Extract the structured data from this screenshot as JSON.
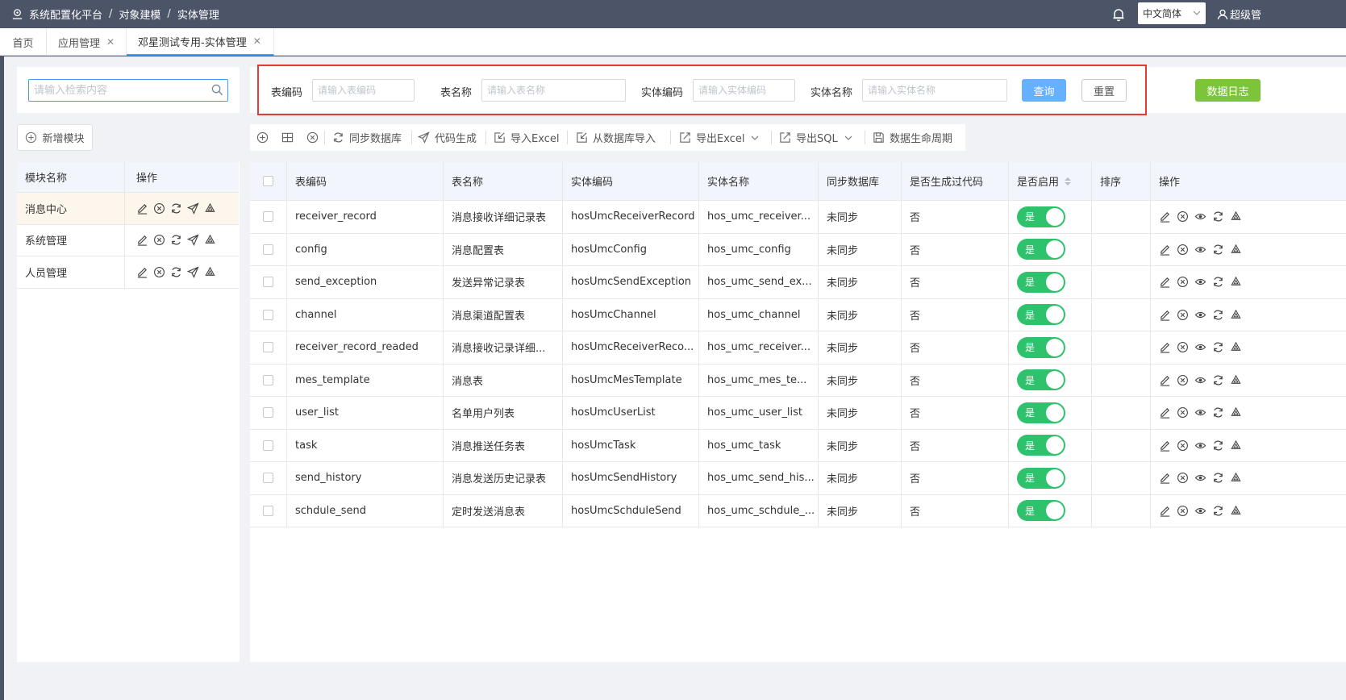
{
  "header": {
    "breadcrumbs": [
      "系统配置化平台",
      "对象建模",
      "实体管理"
    ],
    "language": "中文简体",
    "user": "超级管"
  },
  "tabs": [
    {
      "label": "首页",
      "closable": false
    },
    {
      "label": "应用管理",
      "closable": true
    },
    {
      "label": "邓星测试专用-实体管理",
      "closable": true,
      "active": true
    }
  ],
  "sidebar": {
    "search_placeholder": "请输入检索内容",
    "add_module_label": "新增模块",
    "columns": [
      "模块名称",
      "操作"
    ],
    "modules": [
      {
        "name": "消息中心",
        "selected": true
      },
      {
        "name": "系统管理"
      },
      {
        "name": "人员管理"
      }
    ]
  },
  "filters": {
    "table_code_label": "表编码",
    "table_code_placeholder": "请输入表编码",
    "table_name_label": "表名称",
    "table_name_placeholder": "请输入表名称",
    "entity_code_label": "实体编码",
    "entity_code_placeholder": "请输入实体编码",
    "entity_name_label": "实体名称",
    "entity_name_placeholder": "请输入实体名称",
    "query_label": "查询",
    "reset_label": "重置",
    "data_log_label": "数据日志"
  },
  "toolbar": {
    "sync_db": "同步数据库",
    "code_gen": "代码生成",
    "import_excel": "导入Excel",
    "import_db": "从数据库导入",
    "export_excel": "导出Excel",
    "export_sql": "导出SQL",
    "lifecycle": "数据生命周期"
  },
  "table": {
    "columns": [
      "表编码",
      "表名称",
      "实体编码",
      "实体名称",
      "同步数据库",
      "是否生成过代码",
      "是否启用",
      "排序",
      "操作"
    ],
    "switch_on_label": "是",
    "rows": [
      {
        "code": "receiver_record",
        "name": "消息接收详细记录表",
        "entity_code": "hosUmcReceiverRecord",
        "entity_name": "hos_umc_receiver...",
        "synced": "未同步",
        "generated": "否"
      },
      {
        "code": "config",
        "name": "消息配置表",
        "entity_code": "hosUmcConfig",
        "entity_name": "hos_umc_config",
        "synced": "未同步",
        "generated": "否"
      },
      {
        "code": "send_exception",
        "name": "发送异常记录表",
        "entity_code": "hosUmcSendException",
        "entity_name": "hos_umc_send_ex...",
        "synced": "未同步",
        "generated": "否"
      },
      {
        "code": "channel",
        "name": "消息渠道配置表",
        "entity_code": "hosUmcChannel",
        "entity_name": "hos_umc_channel",
        "synced": "未同步",
        "generated": "否"
      },
      {
        "code": "receiver_record_readed",
        "name": "消息接收记录详细...",
        "entity_code": "hosUmcReceiverReco...",
        "entity_name": "hos_umc_receiver...",
        "synced": "未同步",
        "generated": "否"
      },
      {
        "code": "mes_template",
        "name": "消息表",
        "entity_code": "hosUmcMesTemplate",
        "entity_name": "hos_umc_mes_te...",
        "synced": "未同步",
        "generated": "否"
      },
      {
        "code": "user_list",
        "name": "名单用户列表",
        "entity_code": "hosUmcUserList",
        "entity_name": "hos_umc_user_list",
        "synced": "未同步",
        "generated": "否"
      },
      {
        "code": "task",
        "name": "消息推送任务表",
        "entity_code": "hosUmcTask",
        "entity_name": "hos_umc_task",
        "synced": "未同步",
        "generated": "否"
      },
      {
        "code": "send_history",
        "name": "消息发送历史记录表",
        "entity_code": "hosUmcSendHistory",
        "entity_name": "hos_umc_send_his...",
        "synced": "未同步",
        "generated": "否"
      },
      {
        "code": "schdule_send",
        "name": "定时发送消息表",
        "entity_code": "hosUmcSchduleSend",
        "entity_name": "hos_umc_schdule_...",
        "synced": "未同步",
        "generated": "否"
      }
    ]
  },
  "colors": {
    "topbar": "#4b5567",
    "primary": "#409eff",
    "success": "#2dc26b",
    "data_log": "#7cc53a",
    "highlight_box": "#e5393a"
  }
}
